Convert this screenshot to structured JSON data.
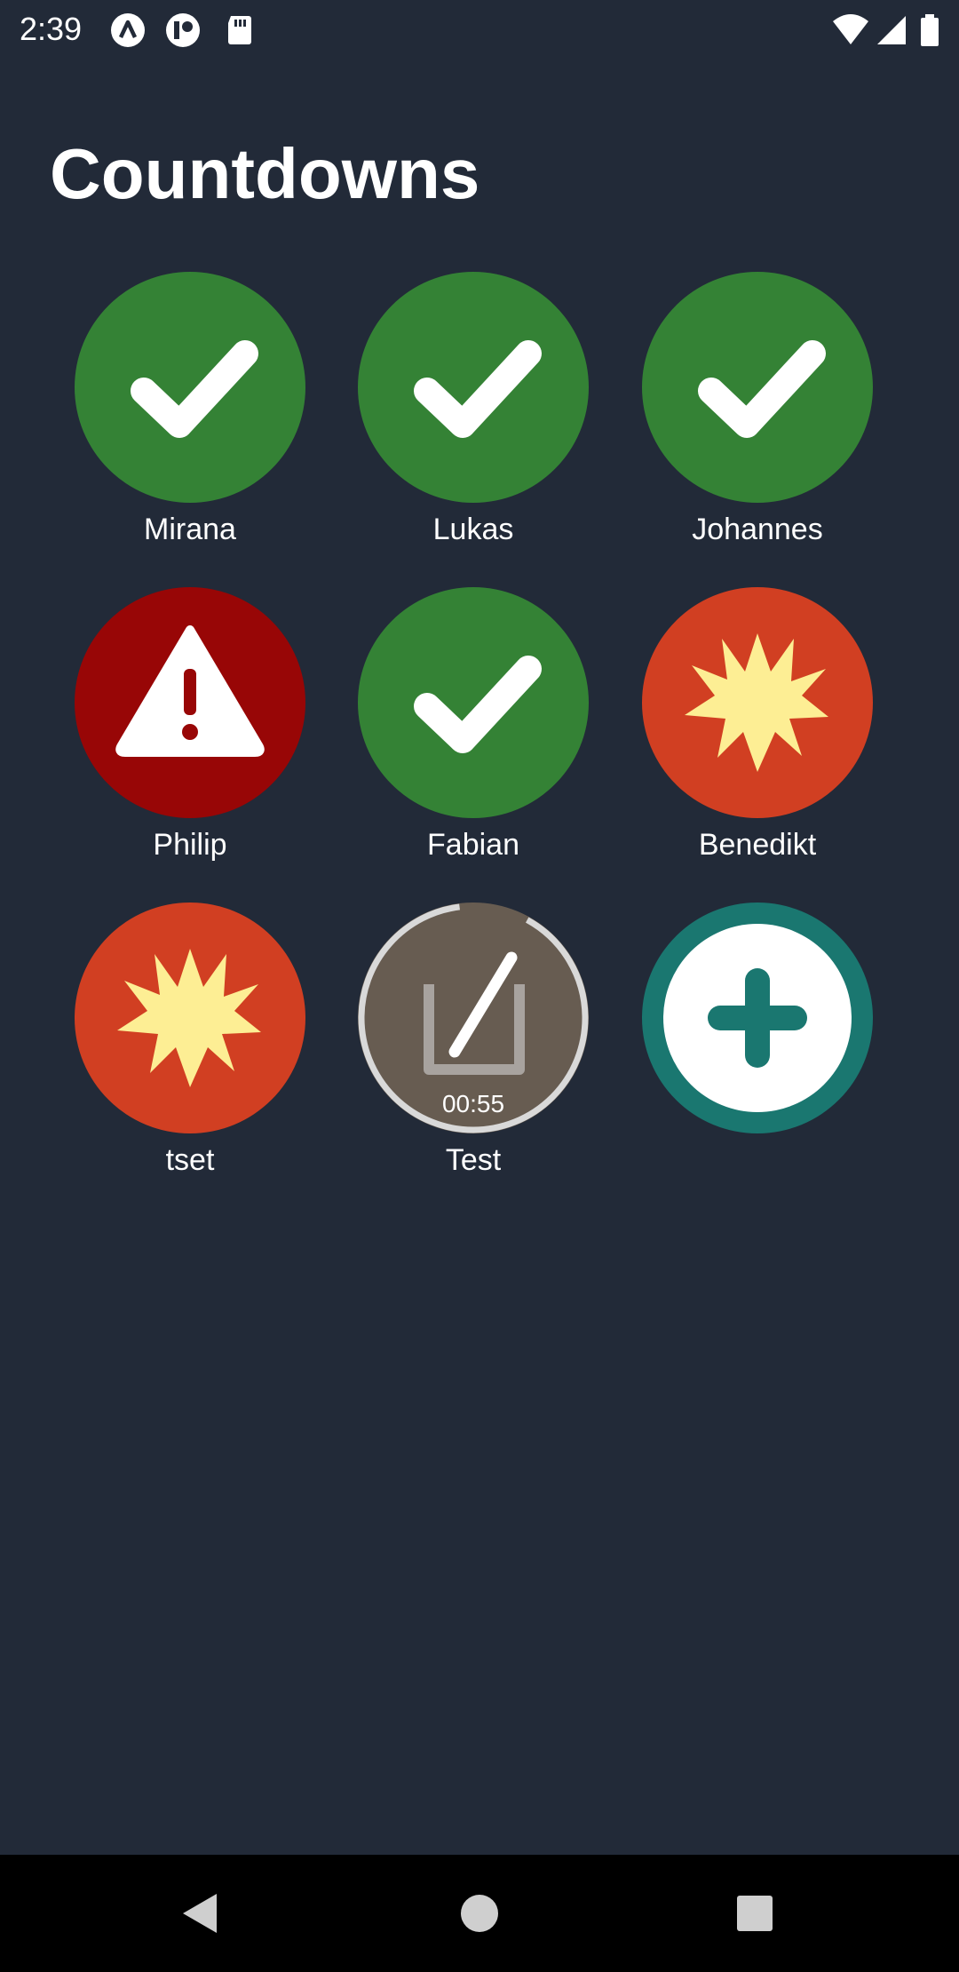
{
  "status_bar": {
    "time": "2:39",
    "left_icons": [
      "app-icon-a",
      "app-icon-b",
      "sd-card-icon"
    ],
    "right_icons": [
      "wifi-icon",
      "signal-icon",
      "battery-icon"
    ]
  },
  "title": "Countdowns",
  "colors": {
    "background": "#222a38",
    "done_green": "#348235",
    "warning_red": "#980606",
    "burst_orange": "#d13f22",
    "burst_yellow": "#fdee94",
    "timer_brown": "#675c51",
    "add_teal": "#1a7770",
    "nav_bar": "#000000"
  },
  "countdowns": [
    {
      "name": "Mirana",
      "state": "done",
      "icon": "checkmark-icon"
    },
    {
      "name": "Lukas",
      "state": "done",
      "icon": "checkmark-icon"
    },
    {
      "name": "Johannes",
      "state": "done",
      "icon": "checkmark-icon"
    },
    {
      "name": "Philip",
      "state": "warning",
      "icon": "warning-icon"
    },
    {
      "name": "Fabian",
      "state": "done",
      "icon": "checkmark-icon"
    },
    {
      "name": "Benedikt",
      "state": "burst",
      "icon": "burst-icon"
    },
    {
      "name": "tset",
      "state": "burst",
      "icon": "burst-icon"
    },
    {
      "name": "Test",
      "state": "running",
      "icon": "hourglass-icon",
      "remaining": "00:55",
      "progress": 0.92
    }
  ],
  "add_button": {
    "icon": "plus-icon",
    "label": ""
  },
  "nav_bar": {
    "buttons": [
      "back-icon",
      "home-icon",
      "recents-icon"
    ]
  }
}
